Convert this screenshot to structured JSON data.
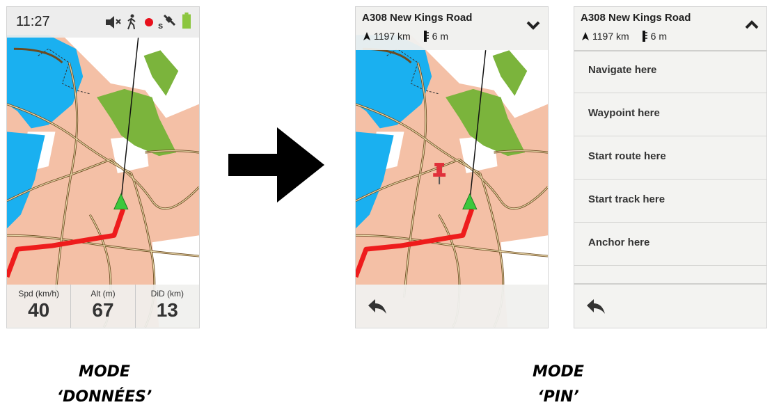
{
  "data_screen": {
    "time": "11:27",
    "status_icons": [
      "mute-icon",
      "hiker-icon",
      "record-dot-icon",
      "satellite-icon",
      "battery-icon"
    ],
    "fields": [
      {
        "label": "Spd (km/h)",
        "value": "40"
      },
      {
        "label": "Alt (m)",
        "value": "67"
      },
      {
        "label": "DiD (km)",
        "value": "13"
      }
    ]
  },
  "pin_screen": {
    "road": "A308  New Kings Road",
    "distance": "1197 km",
    "elevation": "6 m"
  },
  "menu_screen": {
    "road": "A308  New Kings Road",
    "distance": "1197 km",
    "elevation": "6 m",
    "items": [
      "Navigate here",
      "Waypoint here",
      "Start route here",
      "Start track here",
      "Anchor here"
    ]
  },
  "captions": {
    "left_line1": "MODE",
    "left_line2": "‘DONNÉES’",
    "right_line1": "MODE",
    "right_line2": "‘PIN’"
  },
  "colors": {
    "water": "#1ab0f0",
    "urban": "#f4c0a6",
    "park": "#7bb43c",
    "route": "#ee1c1c",
    "cursor": "#3cc83c",
    "pin": "#e0303a"
  }
}
